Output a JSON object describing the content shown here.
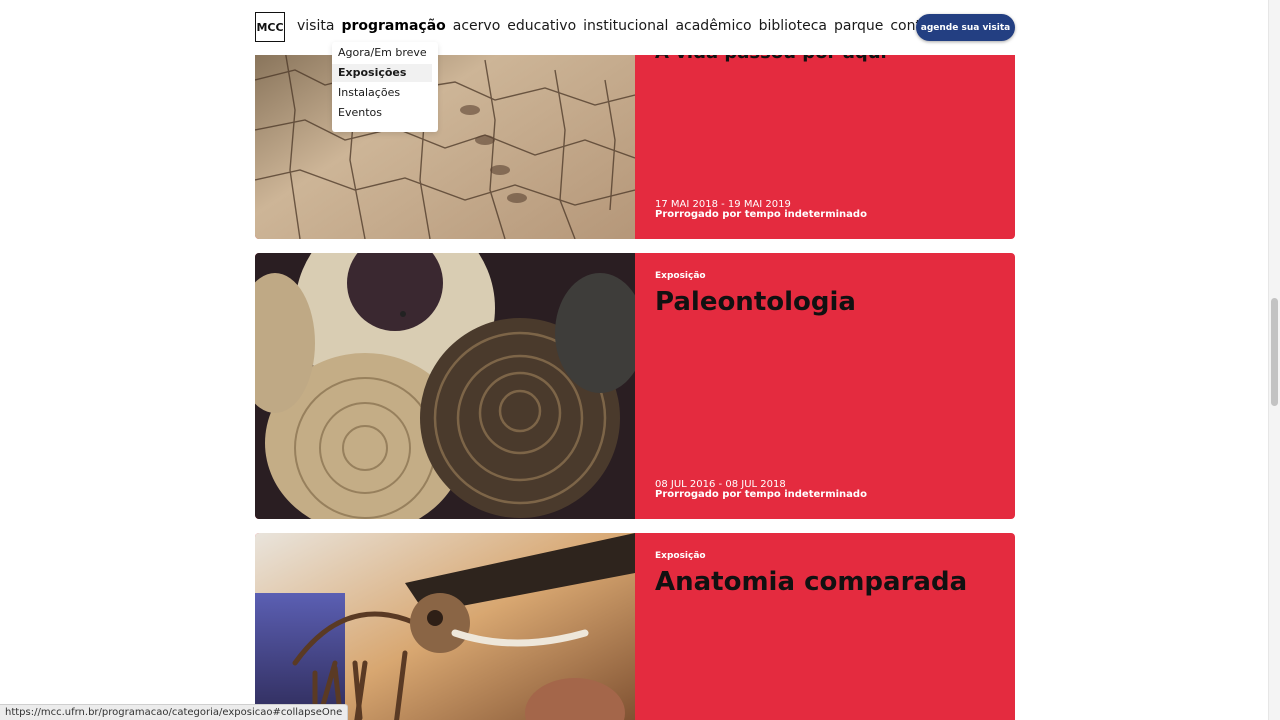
{
  "header": {
    "logo_text": "MCC",
    "nav": [
      "visita",
      "programação",
      "acervo",
      "educativo",
      "institucional",
      "acadêmico",
      "biblioteca",
      "parque",
      "contato"
    ],
    "active_nav": "programação",
    "cta_label": "agende sua visita"
  },
  "dropdown": {
    "items": [
      "Agora/Em breve",
      "Exposições",
      "Instalações",
      "Eventos"
    ],
    "selected": "Exposições"
  },
  "cards": [
    {
      "title": "A vida passou por aqui",
      "dates": "17 MAI 2018 - 19 MAI 2019",
      "extended": "Prorrogado por tempo indeterminado",
      "image": "cracked-earth-fossil-tracks"
    },
    {
      "category": "Exposição",
      "title": "Paleontologia",
      "dates": "08 JUL 2016 - 08 JUL 2018",
      "extended": "Prorrogado por tempo indeterminado",
      "image": "ammonite-fossils"
    },
    {
      "category": "Exposição",
      "title": "Anatomia comparada",
      "image": "elephant-skeleton"
    }
  ],
  "status_url": "https://mcc.ufrn.br/programacao/categoria/exposicao#collapseOne",
  "colors": {
    "card_red": "#e42b3f",
    "cta_blue": "#233f82"
  }
}
